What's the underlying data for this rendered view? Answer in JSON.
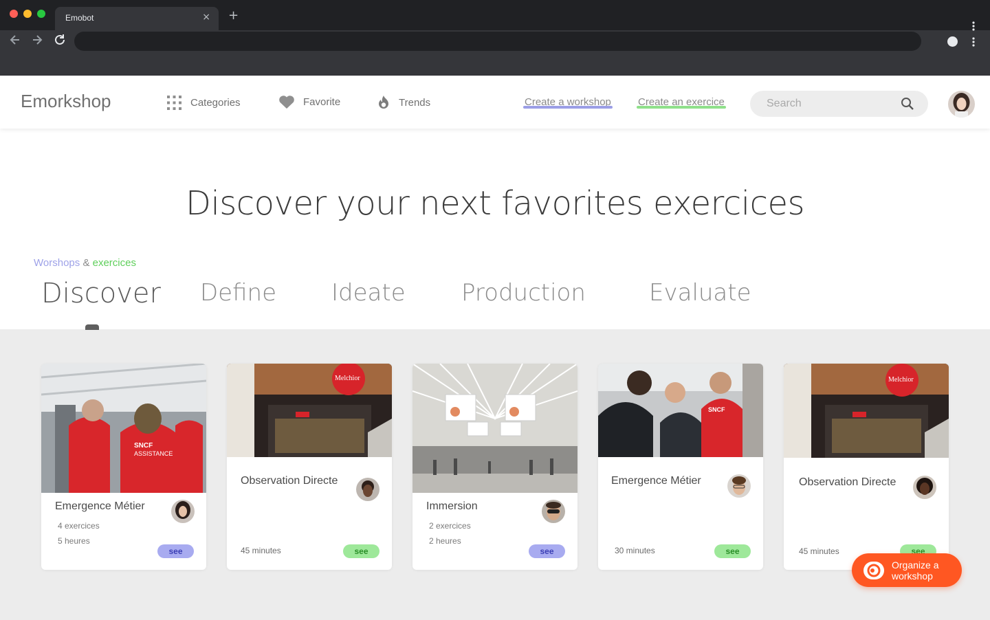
{
  "browser": {
    "tab_title": "Emobot",
    "tab_close": "×",
    "new_tab": "+",
    "colors": {
      "close": "#ff5f57",
      "minimize": "#febc2e",
      "maximize": "#28c840"
    }
  },
  "header": {
    "brand": "Emorkshop",
    "nav": [
      {
        "label": "Categories",
        "icon": "grid-icon"
      },
      {
        "label": "Favorite",
        "icon": "heart-icon"
      },
      {
        "label": "Trends",
        "icon": "flame-icon"
      }
    ],
    "links": [
      {
        "label": "Create a workshop",
        "underline": "#9b9ee6"
      },
      {
        "label": "Create an exercice",
        "underline": "#8fe08a"
      }
    ],
    "search": {
      "placeholder": "Search",
      "icon": "search-icon"
    }
  },
  "hero": {
    "title": "Discover your next favorites exercices"
  },
  "filter": {
    "workshops": "Worshops",
    "amp": "&",
    "exercices": "exercices",
    "workshops_color": "#9ea2e8",
    "exercices_color": "#5fcf5b"
  },
  "phases": [
    {
      "label": "Discover",
      "active": true
    },
    {
      "label": "Define",
      "active": false
    },
    {
      "label": "Ideate",
      "active": false
    },
    {
      "label": "Production",
      "active": false
    },
    {
      "label": "Evaluate",
      "active": false
    }
  ],
  "cards": [
    {
      "title": "Emergence Métier",
      "type": "workshop",
      "line1": "4 exercices",
      "line2": "5 heures",
      "see": "see"
    },
    {
      "title": "Observation Directe",
      "type": "exercice",
      "duration": "45 minutes",
      "see": "see"
    },
    {
      "title": "Immersion",
      "type": "workshop",
      "line1": "2 exercices",
      "line2": "2 heures",
      "see": "see"
    },
    {
      "title": "Emergence Métier",
      "type": "exercice",
      "duration": "30 minutes",
      "see": "see"
    },
    {
      "title": "Observation Directe",
      "type": "exercice",
      "duration": "45 minutes",
      "see": "see"
    }
  ],
  "fab": {
    "label_line1": "Organize a",
    "label_line2": "workshop",
    "color": "#ff5722"
  },
  "see_colors": {
    "workshop_bg": "#a8abf0",
    "workshop_fg": "#3c40b5",
    "exercice_bg": "#9ee89a",
    "exercice_fg": "#2a8f28"
  }
}
